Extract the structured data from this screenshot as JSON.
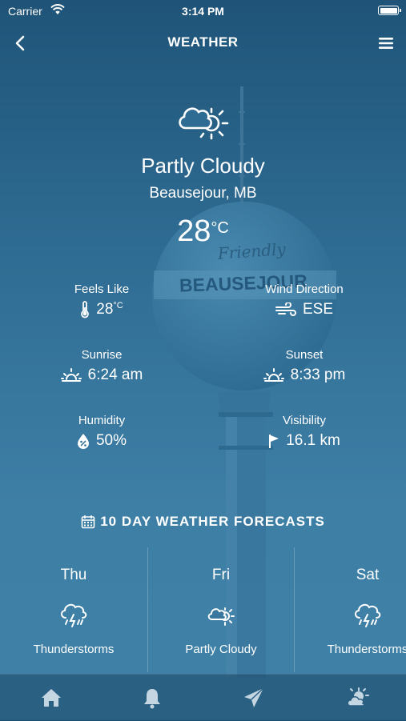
{
  "status_bar": {
    "carrier": "Carrier",
    "time": "3:14 PM"
  },
  "nav": {
    "title": "WEATHER",
    "back_icon": "chevron-left-icon",
    "menu_icon": "hamburger-menu-icon"
  },
  "current": {
    "icon": "partly-cloudy-icon",
    "condition": "Partly Cloudy",
    "location": "Beausejour, MB",
    "temperature": "28",
    "temperature_unit": "°C"
  },
  "details": {
    "feels_like": {
      "label": "Feels Like",
      "value": "28",
      "unit": "°C",
      "icon": "thermometer-icon"
    },
    "wind_direction": {
      "label": "Wind Direction",
      "value": "ESE",
      "icon": "wind-icon"
    },
    "sunrise": {
      "label": "Sunrise",
      "value": "6:24 am",
      "icon": "sunrise-icon"
    },
    "sunset": {
      "label": "Sunset",
      "value": "8:33 pm",
      "icon": "sunset-icon"
    },
    "humidity": {
      "label": "Humidity",
      "value": "50%",
      "icon": "humidity-drop-icon"
    },
    "visibility": {
      "label": "Visibility",
      "value": "16.1 km",
      "icon": "flag-icon"
    }
  },
  "forecast": {
    "heading": "10 DAY WEATHER FORECASTS",
    "heading_icon": "calendar-icon",
    "days": [
      {
        "day": "Thu",
        "description": "Thunderstorms",
        "icon": "thunderstorm-icon"
      },
      {
        "day": "Fri",
        "description": "Partly Cloudy",
        "icon": "partly-cloudy-icon"
      },
      {
        "day": "Sat",
        "description": "Thunderstorms",
        "icon": "thunderstorm-icon"
      }
    ]
  },
  "background": {
    "tower_text_1": "Friendly",
    "tower_text_2": "BEAUSEJOUR"
  },
  "tab_bar": {
    "tabs": [
      {
        "icon": "home-icon"
      },
      {
        "icon": "bell-icon"
      },
      {
        "icon": "send-icon"
      },
      {
        "icon": "weather-icon"
      }
    ]
  },
  "colors": {
    "background_top": "#1f5478",
    "background_bottom": "#3f80a7",
    "text": "#ffffff"
  }
}
